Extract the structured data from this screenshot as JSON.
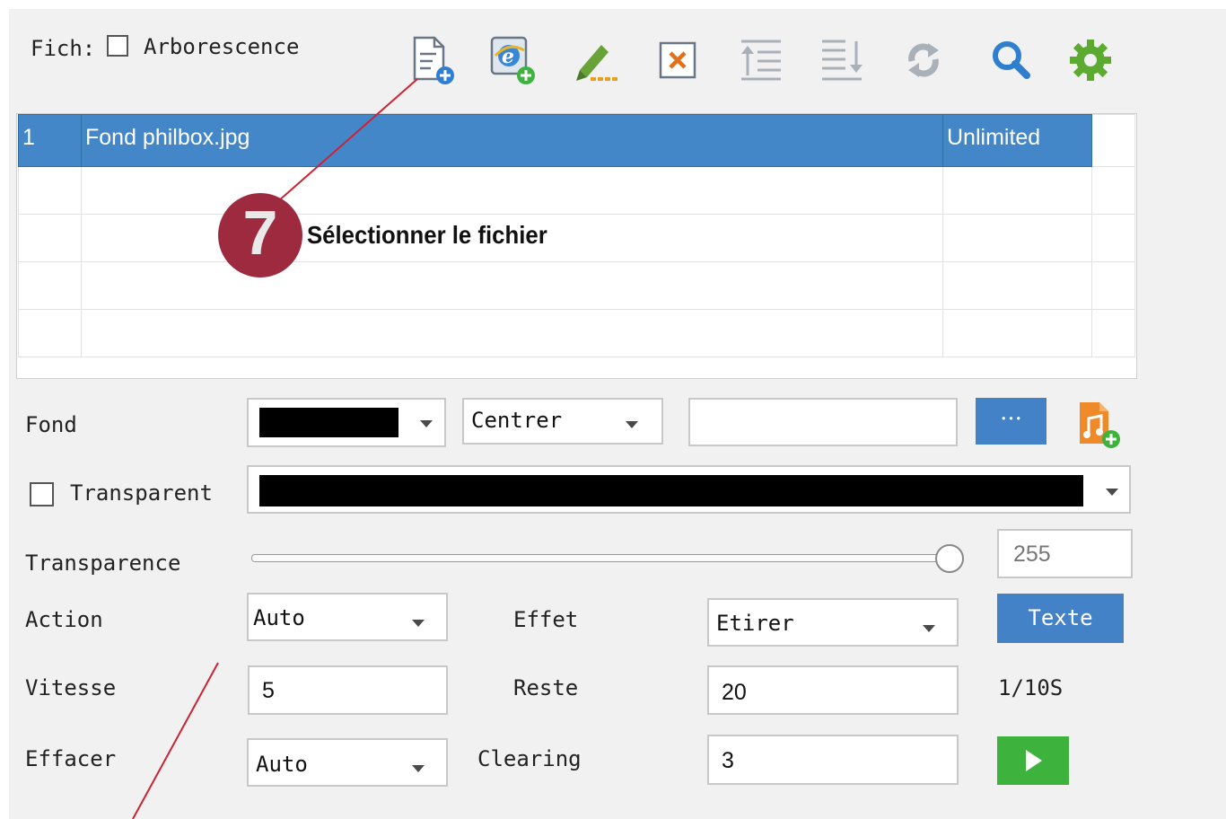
{
  "colors": {
    "accent": "#4382c6",
    "selection": "#4387c8",
    "play": "#3db23d",
    "annotation": "#9e2a40",
    "annotation_line": "#cc2233"
  },
  "file_bar": {
    "label": "Fich:",
    "tree_label": "Arborescence"
  },
  "toolbar": {
    "icons": [
      "add-file-icon",
      "add-web-icon",
      "rename-icon",
      "delete-icon",
      "move-up-icon",
      "move-down-icon",
      "refresh-icon",
      "search-icon",
      "settings-icon"
    ]
  },
  "file_table": {
    "rows": [
      {
        "index": "1",
        "name": "Fond philbox.jpg",
        "duration": "Unlimited",
        "selected": true
      },
      {
        "index": "",
        "name": "",
        "duration": ""
      },
      {
        "index": "",
        "name": "",
        "duration": ""
      },
      {
        "index": "",
        "name": "",
        "duration": ""
      },
      {
        "index": "",
        "name": "",
        "duration": ""
      }
    ]
  },
  "background": {
    "label": "Fond",
    "color_value": "#000000",
    "position_value": "Centrer",
    "path_value": "",
    "browse_label": "···"
  },
  "transparent": {
    "label": "Transparent",
    "checked": false,
    "color_value": "#000000"
  },
  "transparency": {
    "label": "Transparence",
    "value": "255",
    "level_fraction": 1.0
  },
  "action": {
    "label": "Action",
    "value": "Auto"
  },
  "effect": {
    "label": "Effet",
    "value": "Etirer"
  },
  "text_button": {
    "label": "Texte"
  },
  "speed": {
    "label": "Vitesse",
    "value": "5"
  },
  "rest": {
    "label": "Reste",
    "value": "20",
    "unit": "1/10S"
  },
  "clear": {
    "label": "Effacer",
    "value": "Auto"
  },
  "clearing": {
    "label": "Clearing",
    "value": "3"
  },
  "annotation": {
    "number": "7",
    "text": "Sélectionner le fichier"
  }
}
